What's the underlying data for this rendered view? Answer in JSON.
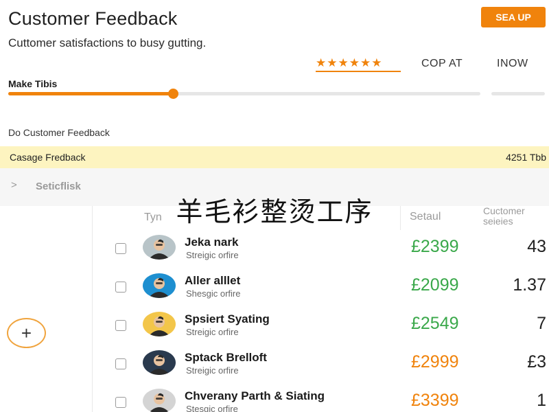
{
  "header": {
    "title": "Customer Feedback",
    "signup_label": "SEA UP",
    "subtitle": "Cuttomer satisfactions to busy gutting."
  },
  "tabs": [
    {
      "label": "★★★★★★",
      "icon": "star-rating-icon",
      "active": true
    },
    {
      "label": "COP AT",
      "active": false
    },
    {
      "label": "INOW",
      "active": false
    }
  ],
  "progress": {
    "label": "Make Tibis",
    "value": 0.35
  },
  "section_heading": "Do Customer Feedback",
  "highlight": {
    "label": "Casage Fredback",
    "value": "4251 Tbb"
  },
  "expand": {
    "chevron": ">",
    "label": "Seticflisk"
  },
  "overlay_caption": "羊毛衫整烫工序",
  "table": {
    "headers": {
      "type": "Tyn",
      "setaul": "Setaul",
      "customer_line1": "Cuctomer",
      "customer_line2": "seieies"
    },
    "rows": [
      {
        "name": "Jeka nark",
        "role": "Streigic orfire",
        "price": "£2399",
        "count": "43",
        "price_color": "#3aa84a",
        "avatar_bg": "#b8c4c8"
      },
      {
        "name": "Aller alllet",
        "role": "Shesgic orfire",
        "price": "£2099",
        "count": "1.37",
        "price_color": "#3aa84a",
        "avatar_bg": "#1e8fd0"
      },
      {
        "name": "Spsiert Syating",
        "role": "Streigic orfire",
        "price": "£2549",
        "count": "7",
        "price_color": "#3aa84a",
        "avatar_bg": "#f3c64a"
      },
      {
        "name": "Sptack Brelloft",
        "role": "Streigic orfire",
        "price": "£2999",
        "count": "£3",
        "price_color": "#f0830c",
        "avatar_bg": "#2a3a4e"
      },
      {
        "name": "Chverany Parth & Siating",
        "role": "Stesgic orfire",
        "price": "£3399",
        "count": "1",
        "price_color": "#f0830c",
        "avatar_bg": "#d4d4d4"
      }
    ]
  },
  "add_button": {
    "label": "+",
    "icon": "plus-icon"
  },
  "colors": {
    "accent": "#f0830c",
    "highlight": "#fdf4c0",
    "positive": "#3aa84a"
  }
}
